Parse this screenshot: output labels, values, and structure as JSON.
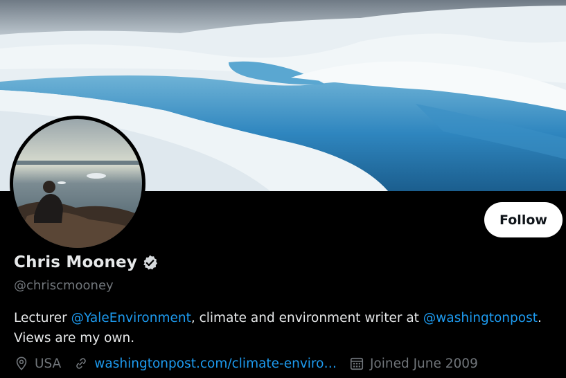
{
  "profile": {
    "display_name": "Chris Mooney",
    "handle": "@chriscmooney",
    "verified": true,
    "follow_label": "Follow",
    "bio": {
      "prefix": "Lecturer ",
      "mention1": "@YaleEnvironment",
      "middle": ", climate and environment writer at ",
      "mention2": "@washingtonpost",
      "suffix": ". Views are my own."
    },
    "meta": {
      "location": "USA",
      "location_icon": "map-pin-icon",
      "website": "washingtonpost.com/climate-enviro…",
      "website_icon": "link-icon",
      "joined": "Joined June 2009",
      "joined_icon": "calendar-icon"
    }
  },
  "colors": {
    "background": "#000000",
    "text_primary": "#e7e9ea",
    "text_secondary": "#71767b",
    "link": "#1d9bf0",
    "follow_button_bg": "#ffffff"
  }
}
